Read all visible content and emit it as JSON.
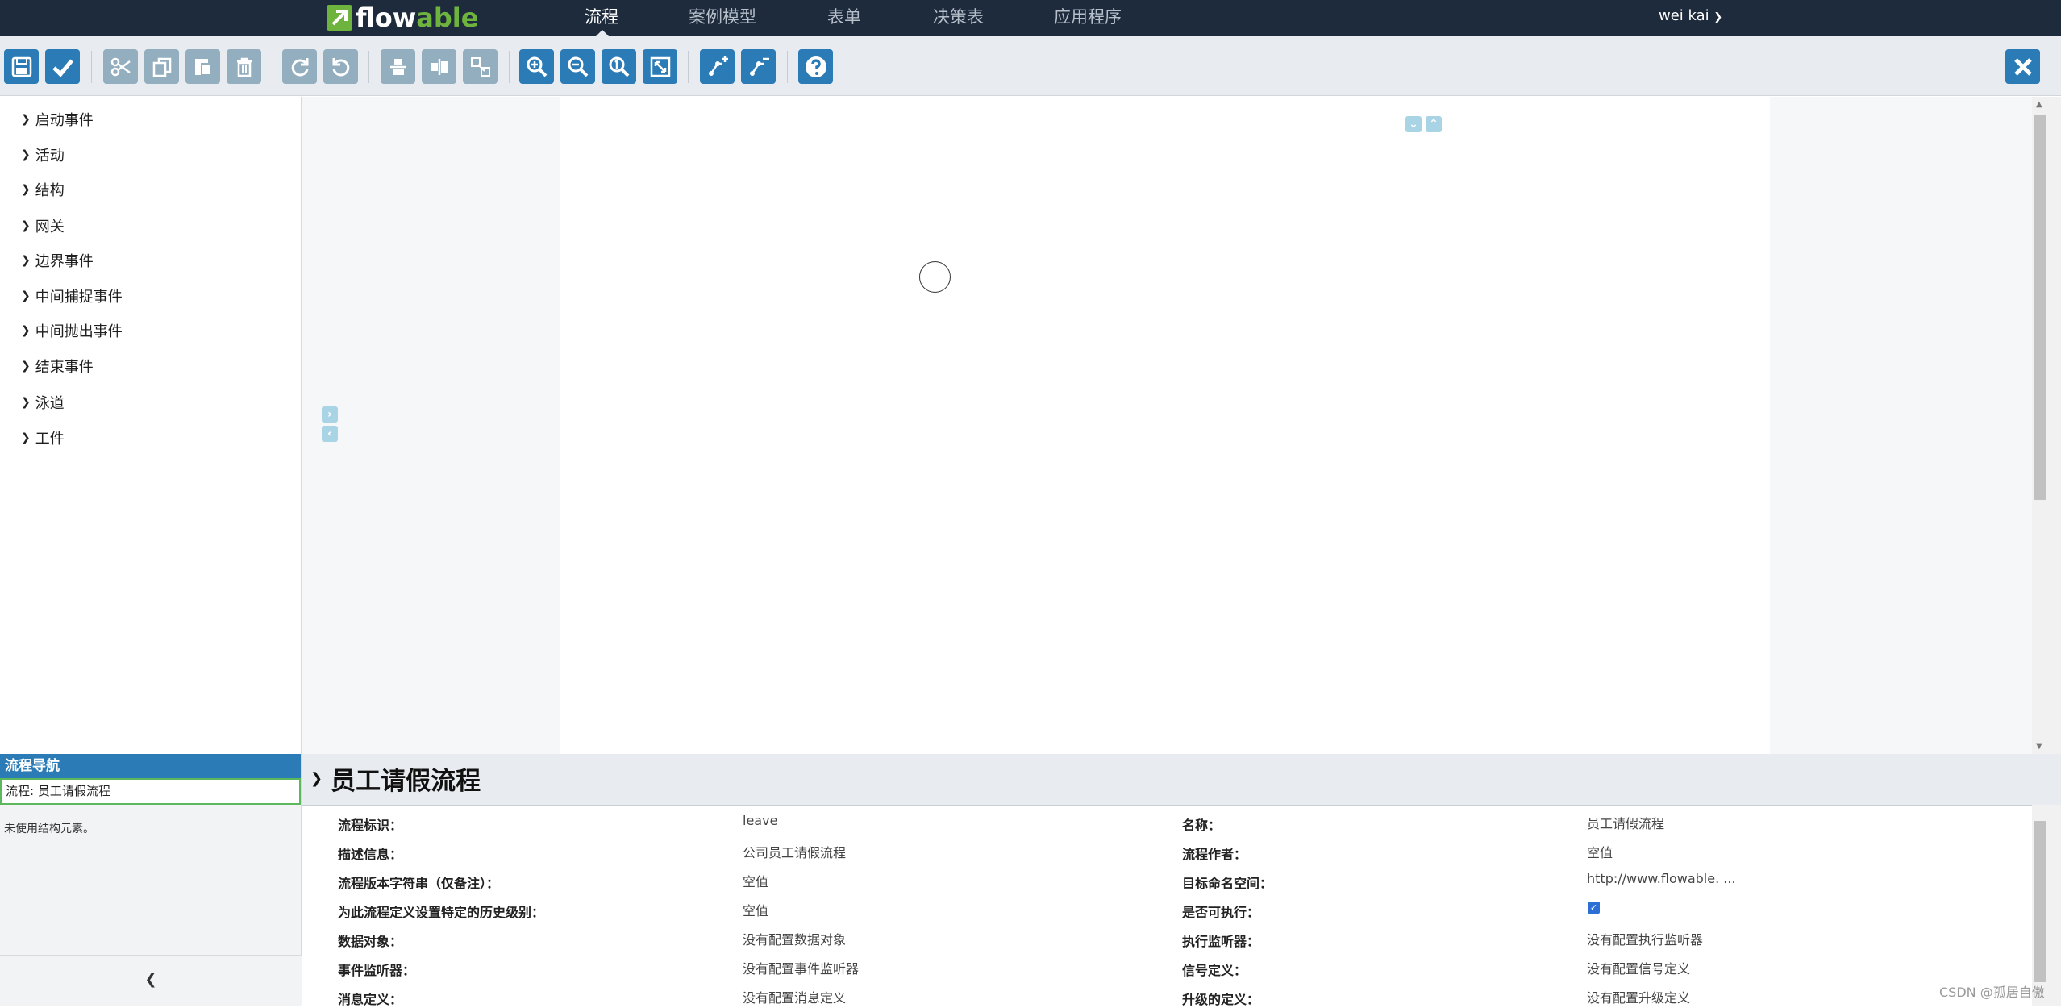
{
  "app": {
    "logo_prefix": "flow",
    "logo_suffix": "able"
  },
  "nav": {
    "items": [
      {
        "label": "流程",
        "active": true
      },
      {
        "label": "案例模型",
        "active": false
      },
      {
        "label": "表单",
        "active": false
      },
      {
        "label": "决策表",
        "active": false
      },
      {
        "label": "应用程序",
        "active": false
      }
    ],
    "user": "wei kai"
  },
  "toolbar": {
    "buttons": [
      {
        "icon": "save-icon",
        "enabled": true
      },
      {
        "icon": "check-icon",
        "enabled": true
      },
      {
        "icon": "cut-icon",
        "enabled": false
      },
      {
        "icon": "copy-icon",
        "enabled": false
      },
      {
        "icon": "paste-icon",
        "enabled": false
      },
      {
        "icon": "delete-icon",
        "enabled": false
      },
      {
        "icon": "redo-icon",
        "enabled": false
      },
      {
        "icon": "undo-icon",
        "enabled": false
      },
      {
        "icon": "align-horizontal-icon",
        "enabled": false
      },
      {
        "icon": "align-vertical-icon",
        "enabled": false
      },
      {
        "icon": "same-size-icon",
        "enabled": false
      },
      {
        "icon": "zoom-in-icon",
        "enabled": true
      },
      {
        "icon": "zoom-out-icon",
        "enabled": true
      },
      {
        "icon": "zoom-actual-icon",
        "enabled": true
      },
      {
        "icon": "zoom-fit-icon",
        "enabled": true
      },
      {
        "icon": "add-bendpoint-icon",
        "enabled": true
      },
      {
        "icon": "remove-bendpoint-icon",
        "enabled": true
      },
      {
        "icon": "help-icon",
        "enabled": true
      }
    ],
    "close_icon": "close-icon"
  },
  "palette": {
    "items": [
      "启动事件",
      "活动",
      "结构",
      "网关",
      "边界事件",
      "中间捕捉事件",
      "中间抛出事件",
      "结束事件",
      "泳道",
      "工件"
    ]
  },
  "navigator": {
    "title": "流程导航",
    "process": "流程: 员工请假流程",
    "empty": "未使用结构元素。"
  },
  "properties": {
    "title": "员工请假流程",
    "left": [
      {
        "label": "流程标识：",
        "value": "leave"
      },
      {
        "label": "描述信息：",
        "value": "公司员工请假流程"
      },
      {
        "label": "流程版本字符串（仅备注）：",
        "value": "空值"
      },
      {
        "label": "为此流程定义设置特定的历史级别：",
        "value": "空值"
      },
      {
        "label": "数据对象：",
        "value": "没有配置数据对象"
      },
      {
        "label": "事件监听器：",
        "value": "没有配置事件监听器"
      },
      {
        "label": "消息定义：",
        "value": "没有配置消息定义"
      }
    ],
    "right": [
      {
        "label": "名称：",
        "value": "员工请假流程"
      },
      {
        "label": "流程作者：",
        "value": "空值"
      },
      {
        "label": "目标命名空间：",
        "value": "http://www.flowable. ..."
      },
      {
        "label": "是否可执行：",
        "value": "",
        "checked": true
      },
      {
        "label": "执行监听器：",
        "value": "没有配置执行监听器"
      },
      {
        "label": "信号定义：",
        "value": "没有配置信号定义"
      },
      {
        "label": "升级的定义：",
        "value": "没有配置升级定义"
      }
    ]
  },
  "watermark": "CSDN @孤居自傲",
  "colors": {
    "nav_bg": "#1e2b3c",
    "accent": "#2b7bb6",
    "logo_green": "#6fb33f"
  }
}
